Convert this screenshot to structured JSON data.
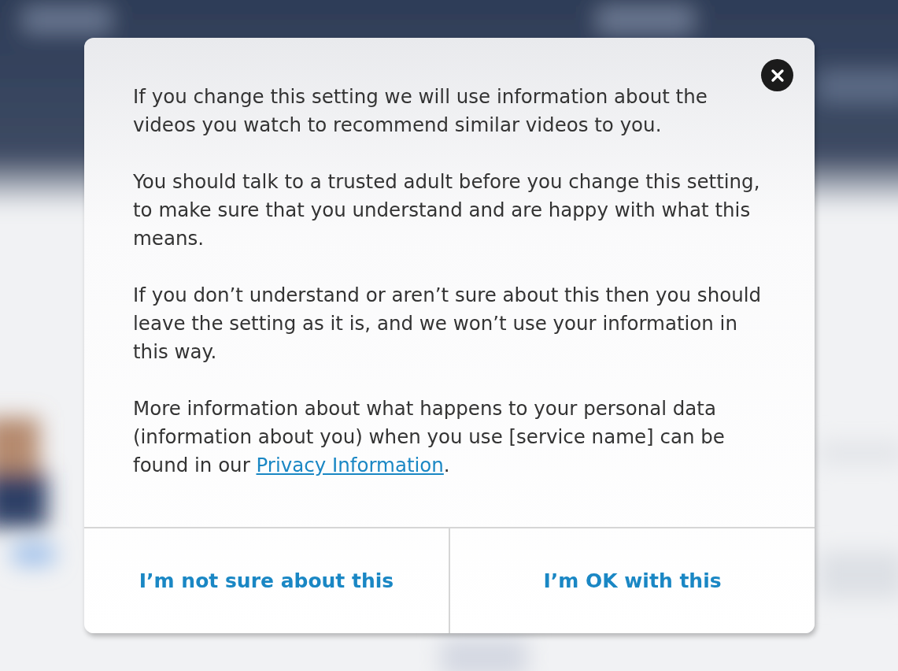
{
  "dialog": {
    "paragraphs": [
      {
        "text": "If you change this setting we will use information about the videos you watch to recommend similar videos to you."
      },
      {
        "text": "You should talk to a trusted adult before you change this setting, to make sure that you understand and are happy with what this means."
      },
      {
        "text": "If you don’t understand or aren’t sure about this then you should leave the setting as it is, and we won’t use your information in this way."
      },
      {
        "text": "More information about what happens to your personal data (information about you) when you use [service name] can be found in our ",
        "link": "Privacy Information",
        "tail": "."
      }
    ],
    "buttons": [
      {
        "label": "I’m not sure about this"
      },
      {
        "label": "I’m OK with this"
      }
    ]
  }
}
